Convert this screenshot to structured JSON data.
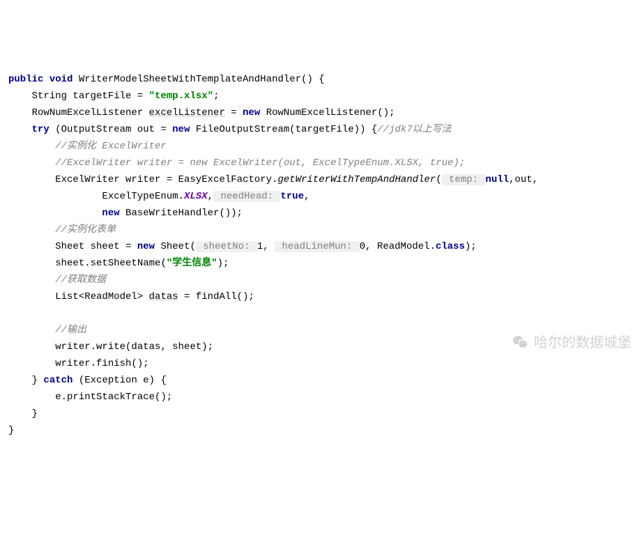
{
  "code": {
    "l1": {
      "kw1": "public",
      "kw2": "void",
      "method": "WriterModelSheetWithTemplateAndHandler() {"
    },
    "l2": {
      "t1": "String targetFile = ",
      "str": "\"temp.xlsx\"",
      "t2": ";"
    },
    "l3": {
      "t1": "RowNumExcelListener ",
      "var": "excelListener",
      "t2": " = ",
      "kw": "new",
      "t3": " RowNumExcelListener();"
    },
    "l4": {
      "kw1": "try",
      "t1": " (OutputStream out = ",
      "kw2": "new",
      "t2": " FileOutputStream(targetFile)) {",
      "cmt": "//jdk7以上写法"
    },
    "l5": {
      "cmt": "//实例化 ExcelWriter"
    },
    "l6": {
      "cmt": "//ExcelWriter writer = new ExcelWriter(out, ExcelTypeEnum.XLSX, true);"
    },
    "l7": {
      "t1": "ExcelWriter writer = EasyExcelFactory.",
      "static": "getWriterWithTempAndHandler",
      "t2": "(",
      "hint": " temp: ",
      "kw": "null",
      "t3": ",out,"
    },
    "l8": {
      "t1": "ExcelTypeEnum.",
      "const": "XLSX",
      "t2": ",",
      "hint": " needHead: ",
      "kw": "true",
      "t3": ","
    },
    "l9": {
      "kw": "new",
      "t1": " BaseWriteHandler());"
    },
    "l10": {
      "cmt": "//实例化表单"
    },
    "l11": {
      "t1": "Sheet sheet = ",
      "kw": "new",
      "t2": " Sheet(",
      "hint1": " sheetNo: ",
      "num1": "1",
      "t3": ", ",
      "hint2": " headLineMun: ",
      "num2": "0",
      "t4": ", ReadModel.",
      "kw2": "class",
      "t5": ");"
    },
    "l12": {
      "t1": "sheet.setSheetName(",
      "str": "\"学生信息\"",
      "t2": ");"
    },
    "l13": {
      "cmt": "//获取数据"
    },
    "l14": {
      "t1": "List<ReadModel> ",
      "var": "datas",
      "t2": " = findAll();"
    },
    "l15": {
      "cmt": "//输出"
    },
    "l16": {
      "t1": "writer.write(datas, sheet);"
    },
    "l17": {
      "t1": "writer.finish();"
    },
    "l18": {
      "t1": "} ",
      "kw": "catch",
      "t2": " (Exception e) {"
    },
    "l19": {
      "t1": "e.printStackTrace();"
    },
    "l20": {
      "t1": "}"
    },
    "l21": {
      "t1": "}"
    }
  },
  "watermark": "哈尔的数据城堡"
}
